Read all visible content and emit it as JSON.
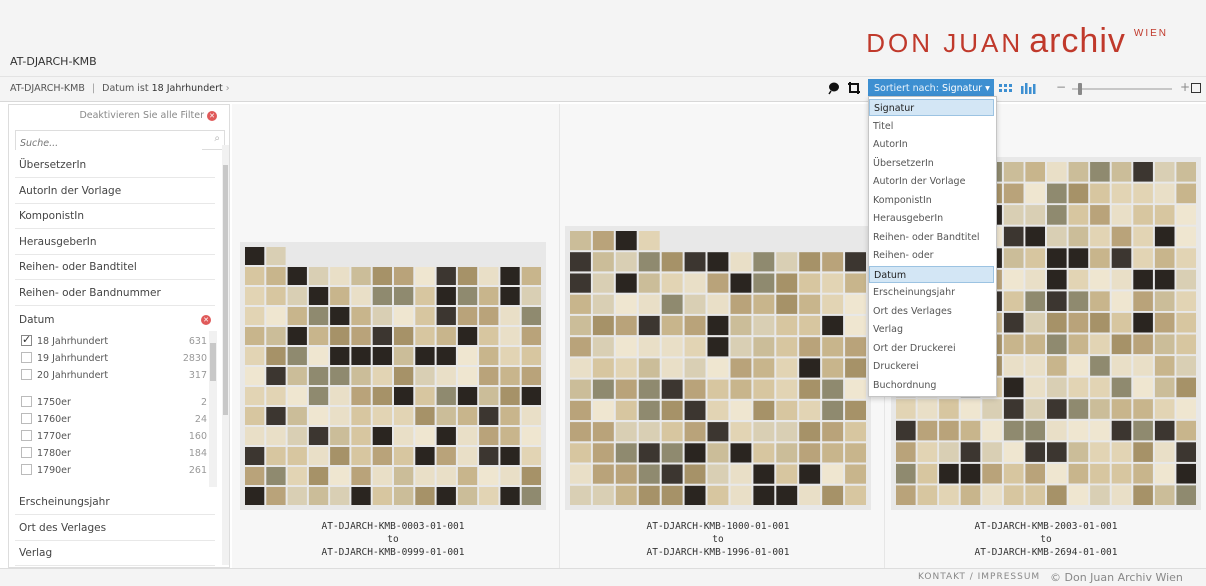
{
  "brand": {
    "part1": "DON JUAN",
    "part2": "archiv",
    "part3": "WIEN"
  },
  "collection_title": "AT-DJARCH-KMB",
  "breadcrumb": {
    "root": "AT-DJARCH-KMB",
    "sep": "|",
    "filter_prefix": "Datum ist",
    "filter_value": "18 Jahrhundert",
    "chevron": "›"
  },
  "toolbar": {
    "sort_prefix": "Sortiert nach:",
    "sort_value": "Signatur ▾",
    "slider_minus": "−",
    "slider_plus": "+"
  },
  "sidebar": {
    "deactivate": "Deaktivieren Sie alle Filter",
    "search_placeholder": "Suche...",
    "facets_top": [
      "ÜbersetzerIn",
      "AutorIn der Vorlage",
      "KomponistIn",
      "HerausgeberIn",
      "Reihen- oder Bandtitel",
      "Reihen- oder Bandnummer"
    ],
    "open_facet": "Datum",
    "options": [
      {
        "label": "18 Jahrhundert",
        "count": "631",
        "checked": true
      },
      {
        "label": "19 Jahrhundert",
        "count": "2830",
        "checked": false
      },
      {
        "label": "20 Jahrhundert",
        "count": "317",
        "checked": false
      },
      {
        "label": "1750er",
        "count": "2",
        "checked": false
      },
      {
        "label": "1760er",
        "count": "24",
        "checked": false
      },
      {
        "label": "1770er",
        "count": "160",
        "checked": false
      },
      {
        "label": "1780er",
        "count": "184",
        "checked": false
      },
      {
        "label": "1790er",
        "count": "261",
        "checked": false
      }
    ],
    "facets_bottom": [
      "Erscheinungsjahr",
      "Ort des Verlages",
      "Verlag"
    ]
  },
  "groups": [
    {
      "from": "AT-DJARCH-KMB-0003-01-001",
      "to_word": "to",
      "to": "AT-DJARCH-KMB-0999-01-001"
    },
    {
      "from": "AT-DJARCH-KMB-1000-01-001",
      "to_word": "to",
      "to": "AT-DJARCH-KMB-1996-01-001"
    },
    {
      "from": "AT-DJARCH-KMB-2003-01-001",
      "to_word": "to",
      "to": "AT-DJARCH-KMB-2694-01-001"
    }
  ],
  "sort_options": [
    "Signatur",
    "Titel",
    "AutorIn",
    "ÜbersetzerIn",
    "AutorIn der Vorlage",
    "KomponistIn",
    "HerausgeberIn",
    "Reihen- oder Bandtitel",
    "Reihen- oder Bandnummer",
    "Datum",
    "Erscheinungsjahr",
    "Ort des Verlages",
    "Verlag",
    "Ort der Druckerei",
    "Druckerei",
    "Buchordnung"
  ],
  "footer": {
    "links": "KONTAKT / IMPRESSUM",
    "copyright": "© Don Juan Archiv Wien"
  },
  "colors": {
    "brand_red": "#c0392b",
    "accent_blue": "#3d8fd1",
    "selected_bg": "#d3e6f5"
  }
}
